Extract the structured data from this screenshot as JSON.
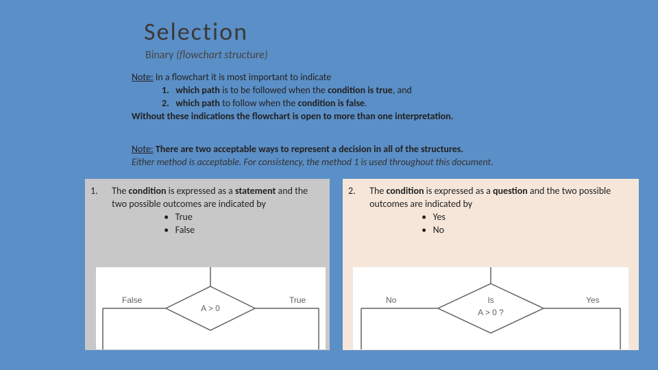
{
  "title": "Selection",
  "subtitle_bold": "Binary",
  "subtitle_italic": "(flowchart structure)",
  "note1": {
    "head": "Note:",
    "lead": " In a flowchart it is most important to indicate",
    "li1_no": "1.",
    "li1_pre": "which path",
    "li1_mid": " is to be followed when the ",
    "li1_b": "condition is true",
    "li1_end": ", and",
    "li2_no": "2.",
    "li2_pre": "which path",
    "li2_mid": " to follow when the ",
    "li2_b": "condition is false",
    "li2_end": ".",
    "close": "Without these indications the flowchart is open to more than one interpretation."
  },
  "note2": {
    "head": "Note:",
    "body": " There are two acceptable ways to represent a decision in all of the structures.",
    "italic": "Either method is acceptable. For consistency, the method 1 is used throughout this document."
  },
  "left": {
    "num": "1.",
    "pre": "The ",
    "b1": "condition",
    "mid1": " is expressed as a ",
    "b2": "statement",
    "mid2": " and the two possible outcomes are indicated by",
    "bul1": "True",
    "bul2": "False"
  },
  "right": {
    "num": "2.",
    "pre": "The ",
    "b1": "condition",
    "mid1": " is expressed as a ",
    "b2": "question",
    "mid2": " and the two possible outcomes are indicated by",
    "bul1": "Yes",
    "bul2": "No"
  },
  "diag_left": {
    "false": "False",
    "true": "True",
    "cond": "A > 0"
  },
  "diag_right": {
    "no": "No",
    "yes": "Yes",
    "l1": "Is",
    "l2": "A > 0 ?"
  }
}
